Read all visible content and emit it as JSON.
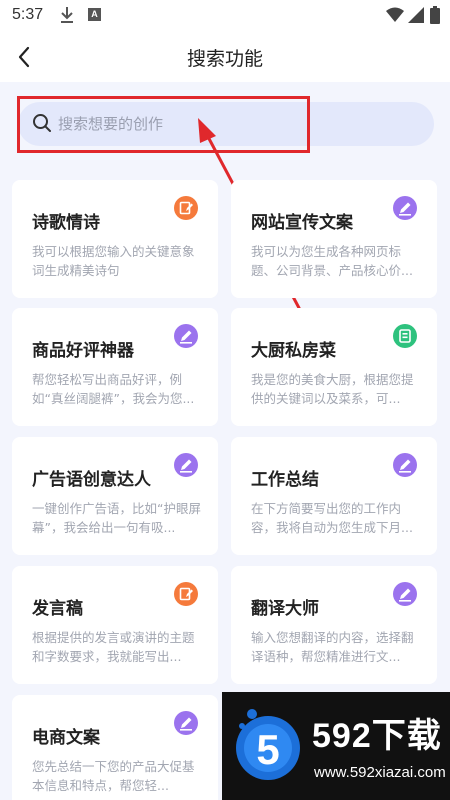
{
  "status_bar": {
    "time": "5:37"
  },
  "header": {
    "title": "搜索功能"
  },
  "search": {
    "placeholder": "搜索想要的创作"
  },
  "cards": [
    {
      "title": "诗歌情诗",
      "desc": "我可以根据您输入的关键意象词生成精美诗句",
      "icon": "notepad-pencil-icon",
      "icon_color": "#f57a3c"
    },
    {
      "title": "网站宣传文案",
      "desc": "我可以为您生成各种网页标题、公司背景、产品核心价...",
      "icon": "pencil-icon",
      "icon_color": "#9b73ee"
    },
    {
      "title": "商品好评神器",
      "desc": "帮您轻松写出商品好评，例如“真丝阔腿裤”，我会为您...",
      "icon": "pencil-icon",
      "icon_color": "#9b73ee"
    },
    {
      "title": "大厨私房菜",
      "desc": "我是您的美食大厨，根据您提供的关键词以及菜系，可...",
      "icon": "document-icon",
      "icon_color": "#2ec27e"
    },
    {
      "title": "广告语创意达人",
      "desc": "一键创作广告语，比如“护眼屏幕”，我会给出一句有吸...",
      "icon": "pencil-icon",
      "icon_color": "#9b73ee"
    },
    {
      "title": "工作总结",
      "desc": "在下方简要写出您的工作内容，我将自动为您生成下月...",
      "icon": "pencil-icon",
      "icon_color": "#9b73ee"
    },
    {
      "title": "发言稿",
      "desc": "根据提供的发言或演讲的主题和字数要求，我就能写出...",
      "icon": "notepad-pencil-icon",
      "icon_color": "#f57a3c"
    },
    {
      "title": "翻译大师",
      "desc": "输入您想翻译的内容，选择翻译语种，帮您精准进行文...",
      "icon": "pencil-icon",
      "icon_color": "#9b73ee"
    },
    {
      "title": "电商文案",
      "desc": "您先总结一下您的产品大促基本信息和特点，帮您轻...",
      "icon": "pencil-icon",
      "icon_color": "#9b73ee"
    }
  ],
  "watermark": {
    "brand": "592下载",
    "url": "www.592xiazai.com",
    "logo_text": "5"
  },
  "colors": {
    "highlight": "#e0282c",
    "search_bg": "#e3e8fb",
    "page_bg": "#f3f5fd"
  }
}
